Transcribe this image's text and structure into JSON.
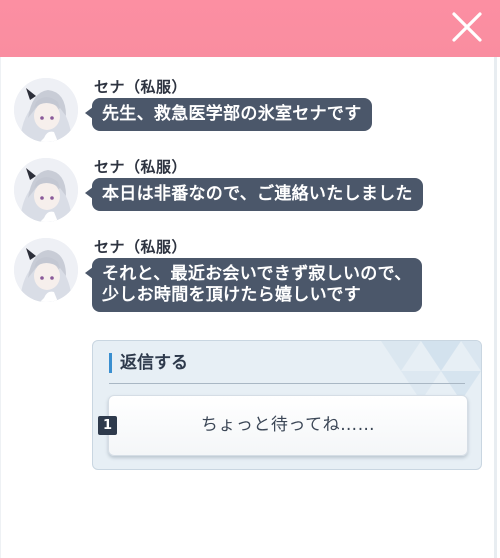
{
  "header": {
    "close_icon": "close-icon",
    "color": "#fc8fa2"
  },
  "messages": [
    {
      "sender": "セナ（私服）",
      "text": "先生、救急医学部の氷室セナです"
    },
    {
      "sender": "セナ（私服）",
      "text": "本日は非番なので、ご連絡いたしました"
    },
    {
      "sender": "セナ（私服）",
      "text": "それと、最近お会いできず寂しいので、\n少しお時間を頂けたら嬉しいです"
    }
  ],
  "reply": {
    "header": "返信する",
    "choices": [
      {
        "number": "1",
        "label": "ちょっと待ってね……"
      }
    ]
  },
  "colors": {
    "bubble": "#4b576a",
    "panel": "#e7eff5",
    "accent": "#3a8fd0"
  }
}
